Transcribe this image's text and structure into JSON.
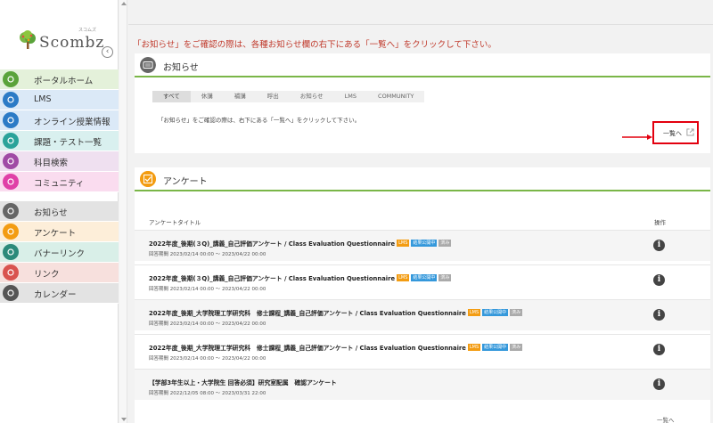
{
  "app": {
    "logo_text": "Scombz",
    "logo_ruby": "スコムズ"
  },
  "nav": {
    "top": [
      {
        "label": "ポータルホーム",
        "icon": "home-icon",
        "bg": "#e4f1da",
        "ic": "#5aa33a"
      },
      {
        "label": "LMS",
        "icon": "graduation-cap-icon",
        "bg": "#dbe9f7",
        "ic": "#2c7bc6"
      },
      {
        "label": "オンライン授業情報",
        "icon": "keyboard-icon",
        "bg": "#dbe9f7",
        "ic": "#2c7bc6"
      },
      {
        "label": "課題・テスト一覧",
        "icon": "book-icon",
        "bg": "#d9f0ef",
        "ic": "#2aa39a"
      },
      {
        "label": "科目検索",
        "icon": "search-icon",
        "bg": "#efe0f0",
        "ic": "#a04ba5"
      },
      {
        "label": "コミュニティ",
        "icon": "search-icon",
        "bg": "#fadcef",
        "ic": "#e040a7"
      }
    ],
    "bottom": [
      {
        "label": "お知らせ",
        "icon": "newspaper-icon",
        "bg": "#e3e3e3",
        "ic": "#666666"
      },
      {
        "label": "アンケート",
        "icon": "checkbox-icon",
        "bg": "#fdeed9",
        "ic": "#f39c12"
      },
      {
        "label": "バナーリンク",
        "icon": "pen-icon",
        "bg": "#d9efe8",
        "ic": "#2b8a7a"
      },
      {
        "label": "リンク",
        "icon": "link-icon",
        "bg": "#f7e0dd",
        "ic": "#d9534f"
      },
      {
        "label": "カレンダー",
        "icon": "calendar-icon",
        "bg": "#e3e3e3",
        "ic": "#555555"
      }
    ]
  },
  "notice": "「お知らせ」をご確認の際は、各種お知らせ欄の右下にある「一覧へ」をクリックして下さい。",
  "announcements": {
    "title": "お知らせ",
    "tabs": [
      "すべて",
      "休講",
      "補講",
      "呼出",
      "お知らせ",
      "LMS",
      "COMMUNITY"
    ],
    "active_tab": "すべて",
    "body": "「お知らせ」をご確認の際は、右下にある「一覧へ」をクリックして下さい。",
    "view_all": "一覧へ"
  },
  "survey": {
    "title": "アンケート",
    "col_title": "アンケートタイトル",
    "col_action": "操作",
    "badges": {
      "lms": "LMS",
      "published": "結果公開中",
      "done": "済み"
    },
    "rows": [
      {
        "title": "2022年度_後期(３Q)_講義_自己評価アンケート / Class Evaluation Questionnaire",
        "period": "回答期間 2023/02/14 00:00 ～ 2023/04/22 00:00",
        "badges": true
      },
      {
        "title": "2022年度_後期(３Q)_講義_自己評価アンケート / Class Evaluation Questionnaire",
        "period": "回答期間 2023/02/14 00:00 ～ 2023/04/22 00:00",
        "badges": true
      },
      {
        "title": "2022年度_後期_大学院理工学研究科　修士課程_講義_自己評価アンケート / Class Evaluation Questionnaire",
        "period": "回答期間 2023/02/14 00:00 ～ 2023/04/22 00:00",
        "badges": true
      },
      {
        "title": "2022年度_後期_大学院理工学研究科　修士課程_講義_自己評価アンケート / Class Evaluation Questionnaire",
        "period": "回答期間 2023/02/14 00:00 ～ 2023/04/22 00:00",
        "badges": true
      },
      {
        "title": "【学部3年生以上・大学院生 回答必須】研究室配属　確認アンケート",
        "period": "回答期間 2022/12/05 08:00 ～ 2023/03/31 22:00",
        "badges": false
      }
    ],
    "view_all": "一覧へ"
  }
}
